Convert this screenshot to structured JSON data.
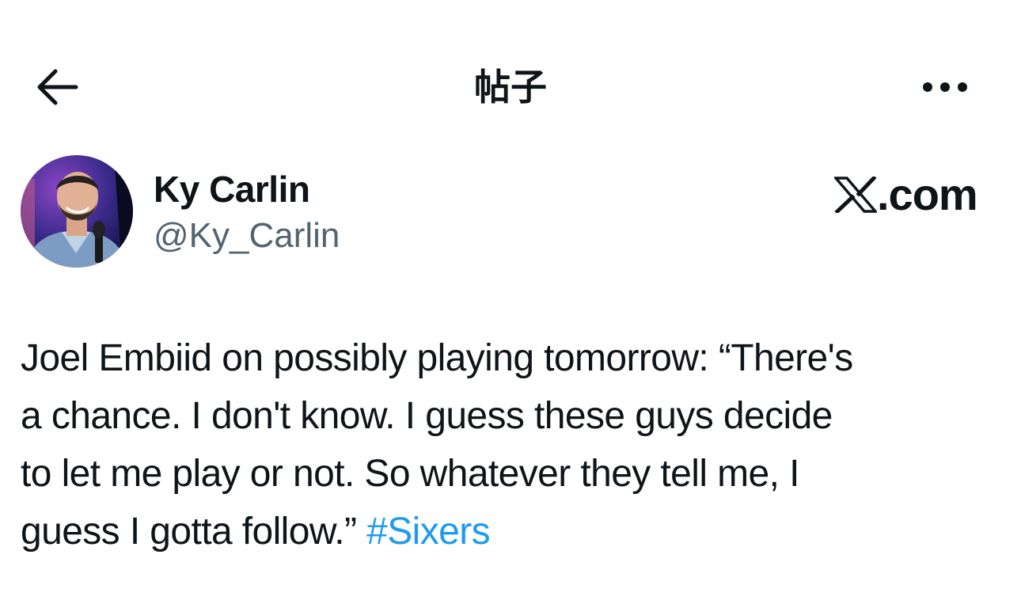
{
  "header": {
    "title": "帖子",
    "back_icon": "arrow-left-icon",
    "more_icon": "more-horizontal-icon"
  },
  "author": {
    "display_name": "Ky Carlin",
    "handle": "@Ky_Carlin"
  },
  "brand": {
    "logo_letter": "𝕏",
    "domain_suffix": ".com"
  },
  "tweet": {
    "lines": [
      "Joel Embiid on possibly playing tomorrow: “There's",
      "a chance. I don't know. I guess these guys decide",
      "to let me play or not. So whatever they tell me, I",
      "guess I gotta follow.” "
    ],
    "hashtag": "#Sixers"
  },
  "colors": {
    "text_primary": "#0f1419",
    "text_secondary": "#536471",
    "link": "#1d9bf0",
    "background": "#ffffff"
  }
}
